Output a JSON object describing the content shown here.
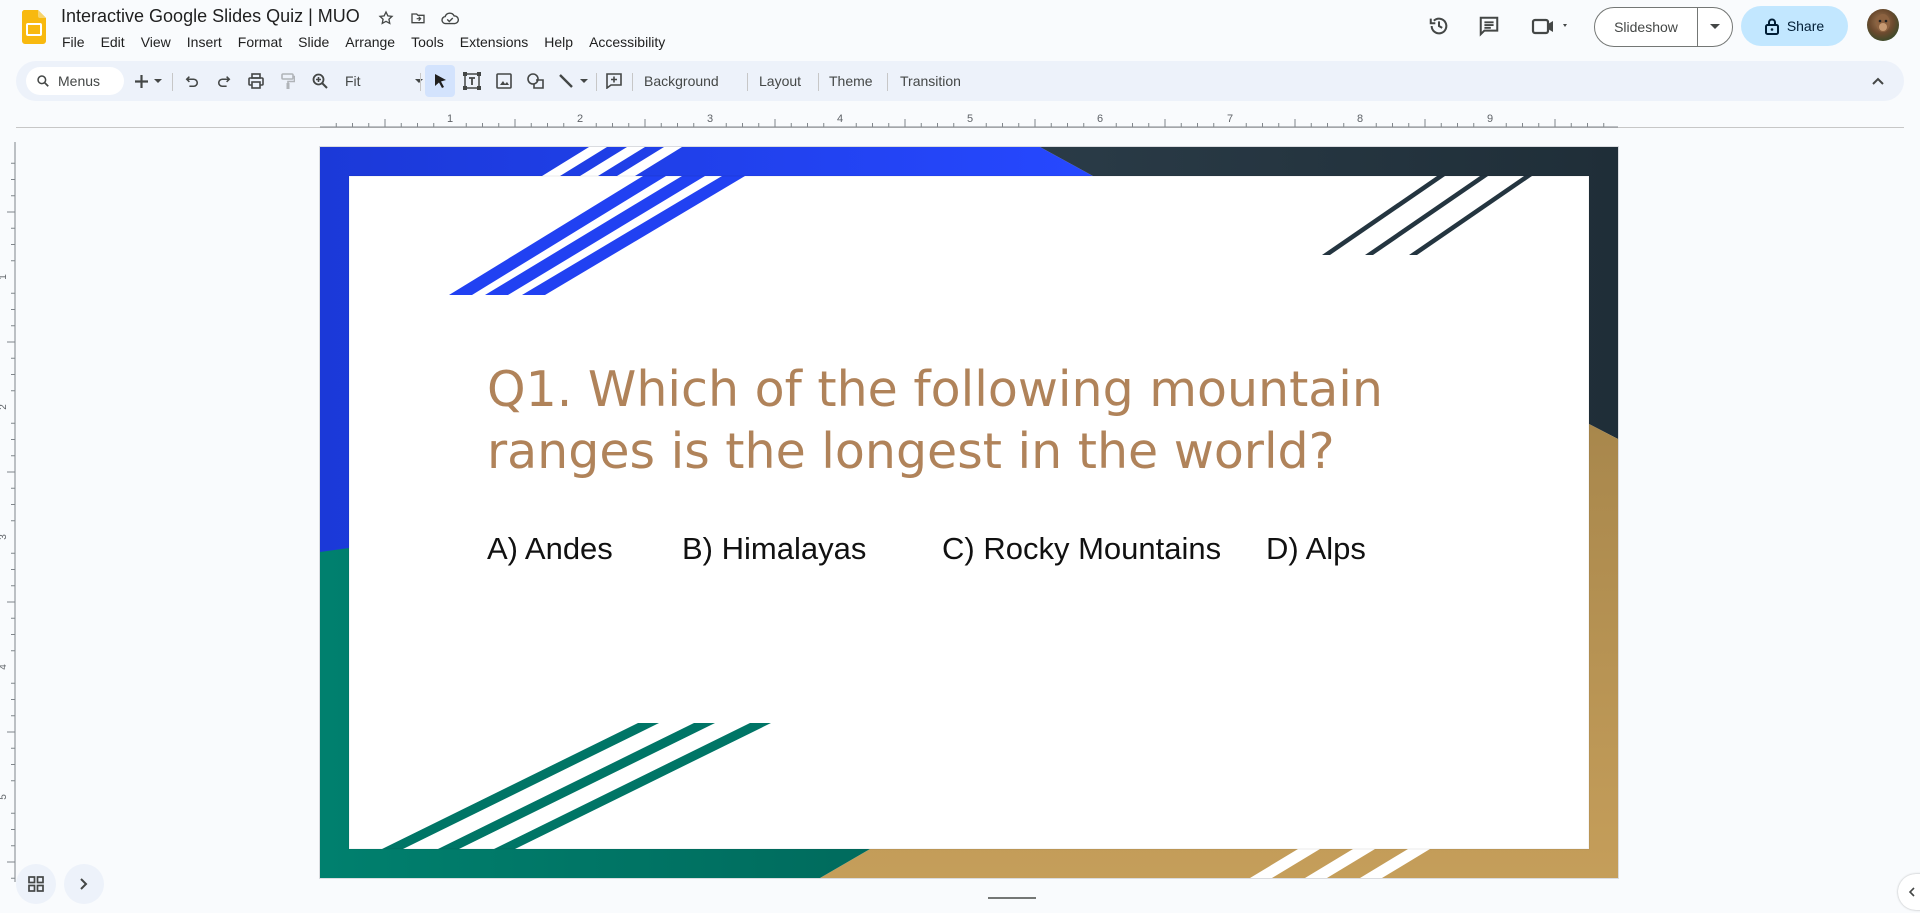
{
  "app": {
    "title": "Interactive Google Slides Quiz | MUO",
    "title_icons": [
      "star-icon",
      "move-to-folder-icon",
      "cloud-saved-icon"
    ]
  },
  "menu": {
    "items": [
      "File",
      "Edit",
      "View",
      "Insert",
      "Format",
      "Slide",
      "Arrange",
      "Tools",
      "Extensions",
      "Help",
      "Accessibility"
    ]
  },
  "header_actions": {
    "icons": [
      "version-history-icon",
      "comments-icon",
      "meet-camera-icon"
    ],
    "slideshow_label": "Slideshow",
    "share_label": "Share"
  },
  "toolbar": {
    "search_placeholder": "Menus",
    "zoom_value": "Fit",
    "background_label": "Background",
    "layout_label": "Layout",
    "theme_label": "Theme",
    "transition_label": "Transition"
  },
  "rulers": {
    "horizontal_labels": [
      "1",
      "2",
      "3",
      "4",
      "5",
      "6",
      "7",
      "8",
      "9"
    ],
    "vertical_labels": [
      "1",
      "2",
      "3",
      "4",
      "5"
    ]
  },
  "slide": {
    "question": "Q1. Which of the following mountain ranges is the longest in the world?",
    "answers": [
      {
        "label": "A) Andes"
      },
      {
        "label": "B) Himalayas"
      },
      {
        "label": "C) Rocky Mountains"
      },
      {
        "label": "D) Alps"
      }
    ],
    "colors": {
      "blue": "#1f3ff0",
      "dark": "#243540",
      "green": "#007566",
      "gold": "#c19d5a",
      "question_text": "#b0835a"
    }
  }
}
